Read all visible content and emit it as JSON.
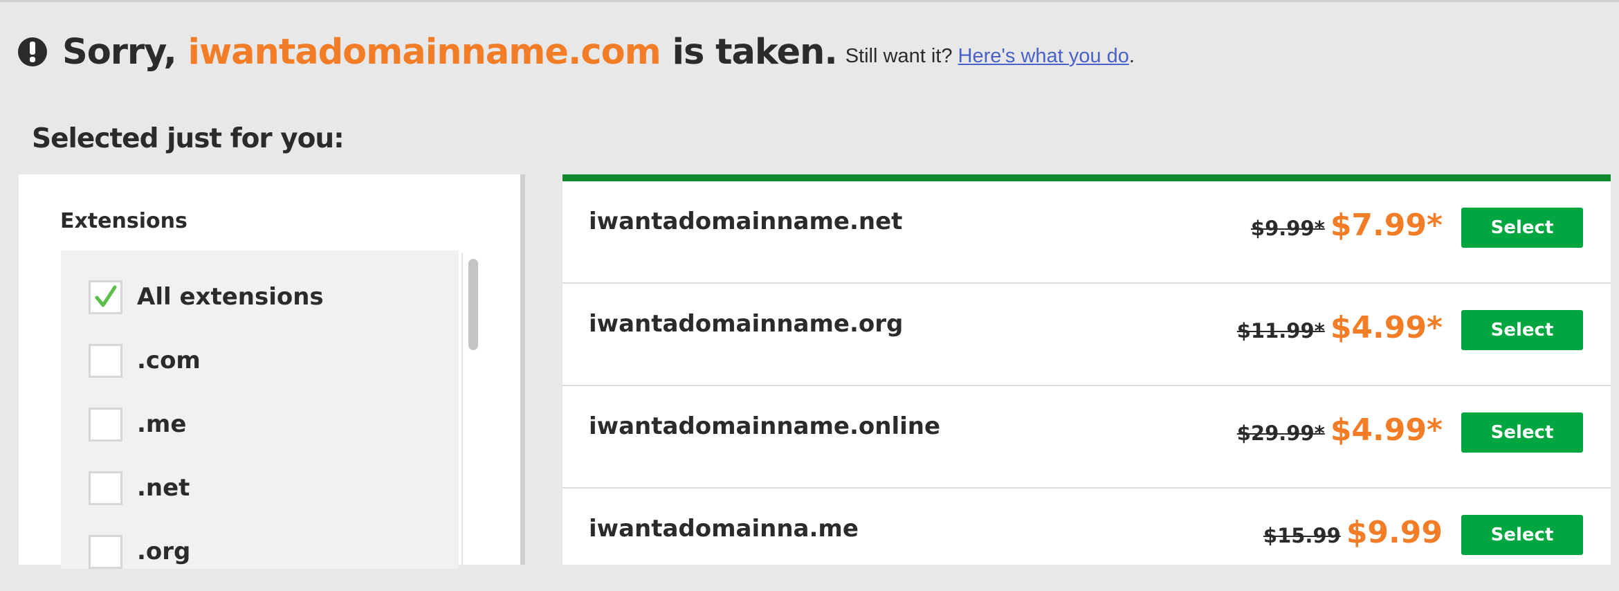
{
  "header": {
    "prefix": "Sorry, ",
    "domain": "iwantadomainname.com",
    "suffix": " is taken.",
    "still_text": "Still want it? ",
    "link_text": "Here's what you do",
    "trailing": "."
  },
  "section_title": "Selected just for you:",
  "filters": {
    "title": "Extensions",
    "items": [
      {
        "label": "All extensions",
        "checked": true
      },
      {
        "label": ".com",
        "checked": false
      },
      {
        "label": ".me",
        "checked": false
      },
      {
        "label": ".net",
        "checked": false
      },
      {
        "label": ".org",
        "checked": false
      }
    ]
  },
  "results": [
    {
      "name": "iwantadomainname.net",
      "old_price": "$9.99*",
      "price": "$7.99*",
      "button": "Select"
    },
    {
      "name": "iwantadomainname.org",
      "old_price": "$11.99*",
      "price": "$4.99*",
      "button": "Select"
    },
    {
      "name": "iwantadomainname.online",
      "old_price": "$29.99*",
      "price": "$4.99*",
      "button": "Select"
    },
    {
      "name": "iwantadomainna.me",
      "old_price": "$15.99",
      "price": "$9.99",
      "button": "Select"
    }
  ],
  "colors": {
    "accent_orange": "#f27d26",
    "button_green": "#00a63f",
    "top_bar_green": "#0f8a2e",
    "link_blue": "#4a62c8"
  },
  "icons": {
    "alert": "exclamation-circle-icon",
    "check": "checkmark-icon"
  }
}
